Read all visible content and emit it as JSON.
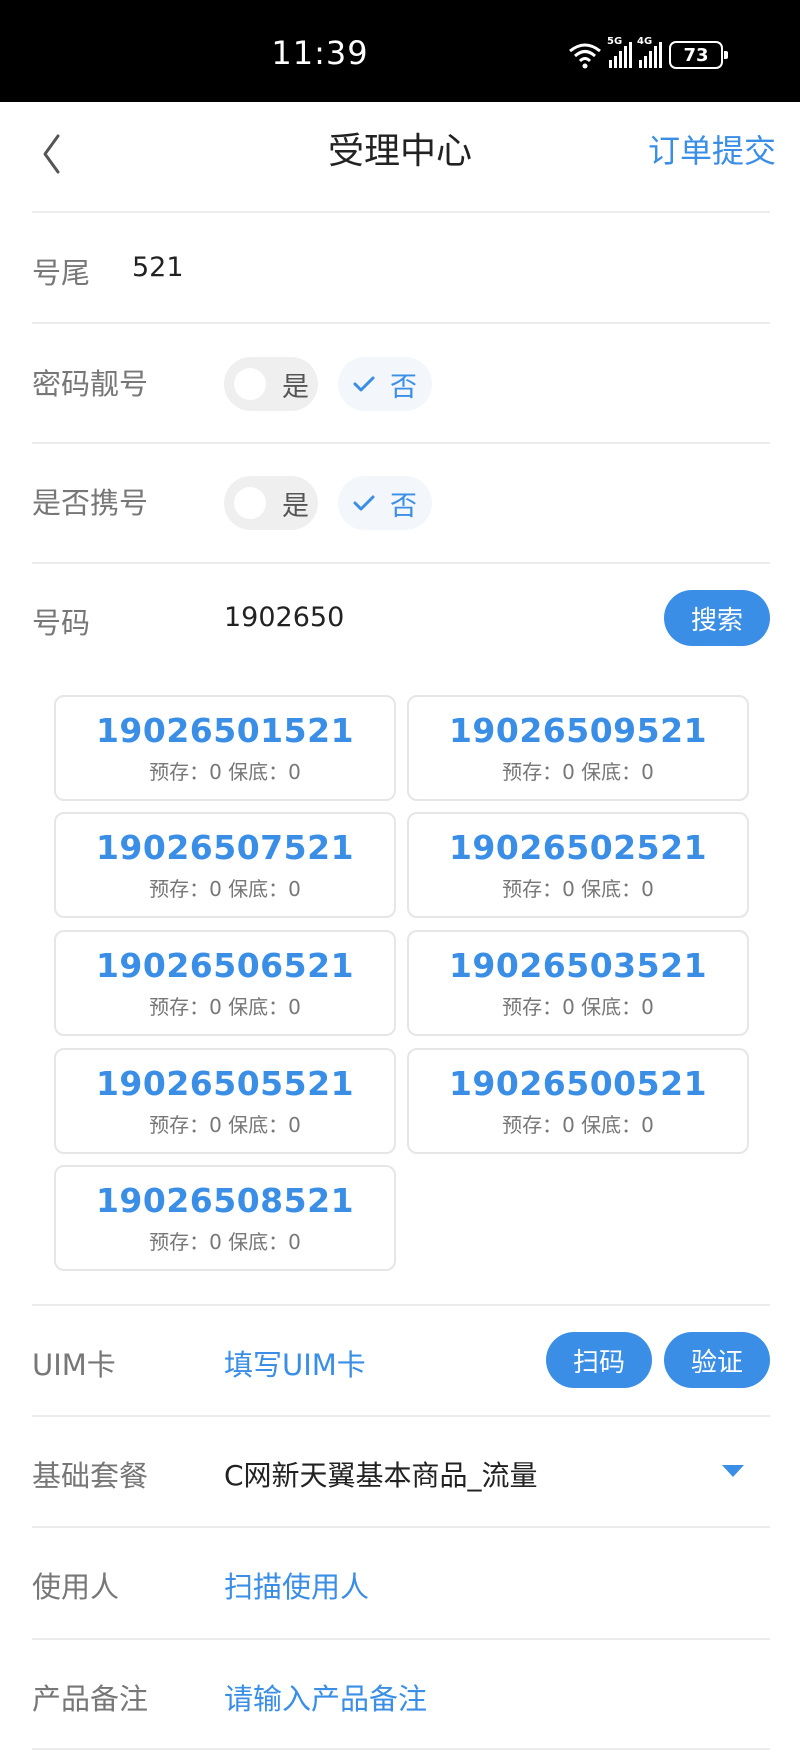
{
  "status_bar": {
    "time": "11:39",
    "net1": "5G",
    "net2": "4G",
    "battery": "73"
  },
  "header": {
    "title": "受理中心",
    "submit": "订单提交"
  },
  "form": {
    "tail": {
      "label": "号尾",
      "value": "521"
    },
    "pretty_number": {
      "label": "密码靓号",
      "yes": "是",
      "no": "否",
      "selected": "否"
    },
    "port_number": {
      "label": "是否携号",
      "yes": "是",
      "no": "否",
      "selected": "否"
    },
    "number": {
      "label": "号码",
      "value": "1902650",
      "search": "搜索"
    },
    "uim": {
      "label": "UIM卡",
      "value": "填写UIM卡",
      "scan": "扫码",
      "verify": "验证"
    },
    "plan": {
      "label": "基础套餐",
      "value": "C网新天翼基本商品_流量"
    },
    "user": {
      "label": "使用人",
      "value": "扫描使用人"
    },
    "remark": {
      "label": "产品备注",
      "placeholder": "请输入产品备注"
    }
  },
  "numbers": [
    {
      "number": "19026501521",
      "meta": "预存：0  保底：0"
    },
    {
      "number": "19026509521",
      "meta": "预存：0  保底：0"
    },
    {
      "number": "19026507521",
      "meta": "预存：0  保底：0"
    },
    {
      "number": "19026502521",
      "meta": "预存：0  保底：0"
    },
    {
      "number": "19026506521",
      "meta": "预存：0  保底：0"
    },
    {
      "number": "19026503521",
      "meta": "预存：0  保底：0"
    },
    {
      "number": "19026505521",
      "meta": "预存：0  保底：0"
    },
    {
      "number": "19026500521",
      "meta": "预存：0  保底：0"
    },
    {
      "number": "19026508521",
      "meta": "预存：0  保底：0"
    }
  ],
  "colors": {
    "accent": "#3a8ee6",
    "label": "#777777",
    "divider": "#ececec"
  },
  "icons": {
    "back": "back-chevron-icon",
    "check": "check-icon",
    "dropdown": "dropdown-caret-icon",
    "wifi": "wifi-icon"
  }
}
